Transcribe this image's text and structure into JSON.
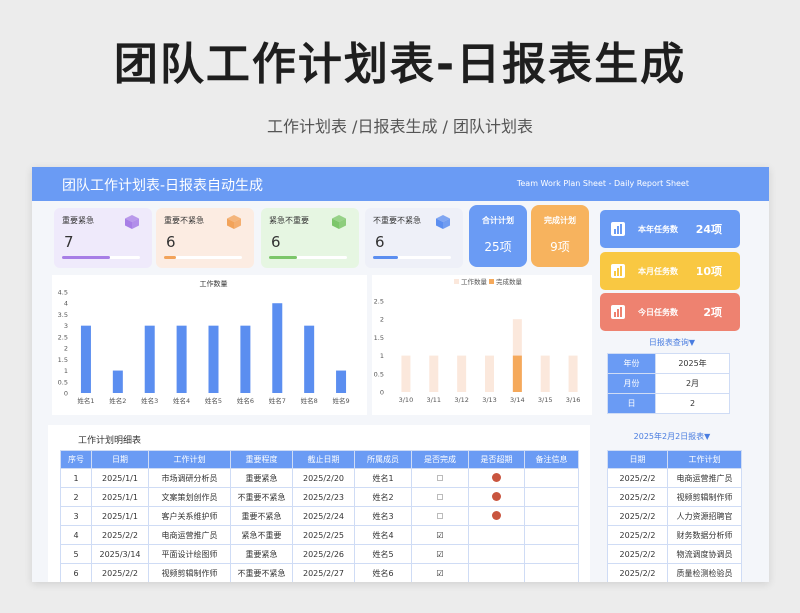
{
  "page": {
    "title": "团队工作计划表-日报表生成",
    "subtitle": "工作计划表 /日报表生成 / 团队计划表"
  },
  "header": {
    "title": "团队工作计划表-日报表自动生成",
    "en_title": "Team Work Plan Sheet - Daily Report Sheet"
  },
  "quadrants": [
    {
      "label": "重要紧急",
      "value": "7",
      "fill": 0.62,
      "bg": "#efeafb",
      "accent": "#a77ee6"
    },
    {
      "label": "重要不紧急",
      "value": "6",
      "fill": 0.16,
      "bg": "#fcece2",
      "accent": "#f2a35a"
    },
    {
      "label": "紧急不重要",
      "value": "6",
      "fill": 0.36,
      "bg": "#e6f6e2",
      "accent": "#7cc66a"
    },
    {
      "label": "不重要不紧急",
      "value": "6",
      "fill": 0.32,
      "bg": "#eef0f8",
      "accent": "#5b8ef0"
    }
  ],
  "summary": {
    "total": {
      "label": "合计计划",
      "value": "25项",
      "color": "#6a9bf4"
    },
    "done": {
      "label": "完成计划",
      "value": "9项",
      "color": "#f7b35e"
    }
  },
  "stats": [
    {
      "label": "本年任务数",
      "value": "24项",
      "color": "#6a9bf4",
      "icon": "bar-chart-icon"
    },
    {
      "label": "本月任务数",
      "value": "10项",
      "color": "#f9c842",
      "icon": "bar-chart-icon"
    },
    {
      "label": "今日任务数",
      "value": "2项",
      "color": "#ee8270",
      "icon": "bar-chart-icon"
    }
  ],
  "query": {
    "link": "日报表查询▼",
    "rows": [
      {
        "key": "年份",
        "value": "2025年"
      },
      {
        "key": "月份",
        "value": "2月"
      },
      {
        "key": "日",
        "value": "2"
      }
    ]
  },
  "chart_data": [
    {
      "type": "bar",
      "title": "工作数量",
      "categories": [
        "姓名1",
        "姓名2",
        "姓名3",
        "姓名4",
        "姓名5",
        "姓名6",
        "姓名7",
        "姓名8",
        "姓名9"
      ],
      "values": [
        3,
        1,
        3,
        3,
        3,
        3,
        4,
        3,
        1
      ],
      "ylim": [
        0,
        4.5
      ],
      "yticks": [
        "0",
        "0.5",
        "1",
        "1.5",
        "2",
        "2.5",
        "3",
        "3.5",
        "4",
        "4.5"
      ],
      "color": "#5b8ef0",
      "grid": false
    },
    {
      "type": "bar",
      "categories": [
        "3/10",
        "3/11",
        "3/12",
        "3/13",
        "3/14",
        "3/15",
        "3/16"
      ],
      "series": [
        {
          "name": "工作数量",
          "values": [
            1,
            1,
            1,
            1,
            2,
            1,
            1
          ],
          "color": "#fbe8dc"
        },
        {
          "name": "完成数量",
          "values": [
            0,
            0,
            0,
            0,
            1,
            0,
            0
          ],
          "color": "#f5a95b"
        }
      ],
      "ylim": [
        0,
        2.5
      ],
      "yticks": [
        "0",
        "0.5",
        "1",
        "1.5",
        "2",
        "2.5"
      ],
      "legend": "top-center",
      "grid": false
    }
  ],
  "detail": {
    "title": "工作计划明细表",
    "columns": [
      "序号",
      "日期",
      "工作计划",
      "重要程度",
      "截止日期",
      "所属成员",
      "是否完成",
      "是否超期",
      "备注信息"
    ],
    "rows": [
      {
        "no": "1",
        "date": "2025/1/1",
        "plan": "市场调研分析员",
        "level": "重要紧急",
        "due": "2025/2/20",
        "member": "姓名1",
        "done": false,
        "overdue": true
      },
      {
        "no": "2",
        "date": "2025/1/1",
        "plan": "文案策划创作员",
        "level": "不重要不紧急",
        "due": "2025/2/23",
        "member": "姓名2",
        "done": false,
        "overdue": true
      },
      {
        "no": "3",
        "date": "2025/1/1",
        "plan": "客户关系维护师",
        "level": "重要不紧急",
        "due": "2025/2/24",
        "member": "姓名3",
        "done": false,
        "overdue": true
      },
      {
        "no": "4",
        "date": "2025/2/2",
        "plan": "电商运营推广员",
        "level": "紧急不重要",
        "due": "2025/2/25",
        "member": "姓名4",
        "done": true,
        "overdue": false
      },
      {
        "no": "5",
        "date": "2025/3/14",
        "plan": "平面设计绘图师",
        "level": "重要紧急",
        "due": "2025/2/26",
        "member": "姓名5",
        "done": true,
        "overdue": false
      },
      {
        "no": "6",
        "date": "2025/2/2",
        "plan": "视频剪辑制作师",
        "level": "不重要不紧急",
        "due": "2025/2/27",
        "member": "姓名6",
        "done": true,
        "overdue": false
      }
    ]
  },
  "daily": {
    "link": "2025年2月2日报表▼",
    "columns": [
      "日期",
      "工作计划"
    ],
    "rows": [
      [
        "2025/2/2",
        "电商运营推广员"
      ],
      [
        "2025/2/2",
        "视频剪辑制作师"
      ],
      [
        "2025/2/2",
        "人力资源招聘官"
      ],
      [
        "2025/2/2",
        "财务数据分析师"
      ],
      [
        "2025/2/2",
        "物流调度协调员"
      ],
      [
        "2025/2/2",
        "质量检测检验员"
      ]
    ]
  },
  "marks": {
    "checked": "☑",
    "unchecked": "□"
  }
}
